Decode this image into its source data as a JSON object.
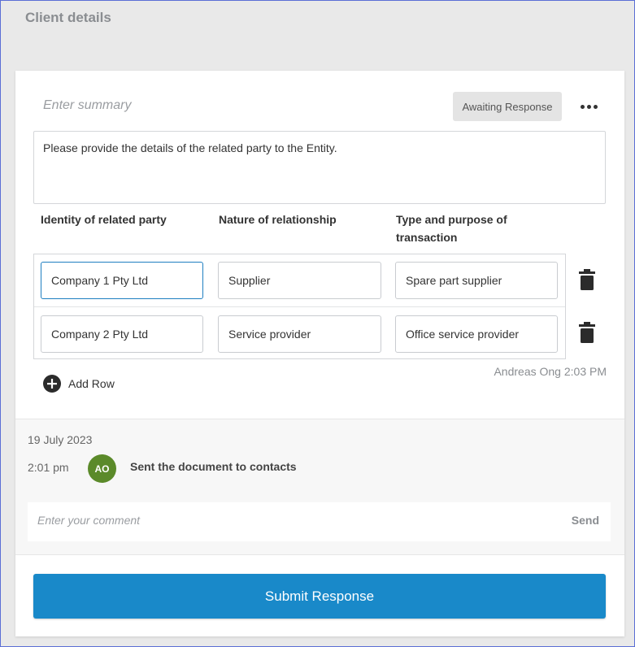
{
  "page": {
    "title": "Client details"
  },
  "card": {
    "summary_placeholder": "Enter summary",
    "status": "Awaiting Response",
    "description": "Please provide the details of the related party to the Entity.",
    "columns": [
      "Identity of related party",
      "Nature of relationship",
      "Type and purpose of transaction"
    ],
    "rows": [
      [
        "Company 1 Pty Ltd",
        "Supplier",
        "Spare part supplier"
      ],
      [
        "Company 2 Pty Ltd",
        "Service provider",
        "Office service provider"
      ]
    ],
    "add_row_label": "Add Row",
    "author_time": "Andreas Ong 2:03 PM"
  },
  "activity": {
    "date": "19 July 2023",
    "time": "2:01 pm",
    "avatar_initials": "AO",
    "avatar_color": "#5b8a2a",
    "message": "Sent the document to contacts",
    "comment_placeholder": "Enter your comment",
    "send_label": "Send"
  },
  "submit": {
    "label": "Submit Response",
    "color": "#1989c9"
  },
  "icons": {
    "more": "more-horizontal-icon",
    "trash": "trash-icon",
    "add": "plus-circle-icon"
  }
}
